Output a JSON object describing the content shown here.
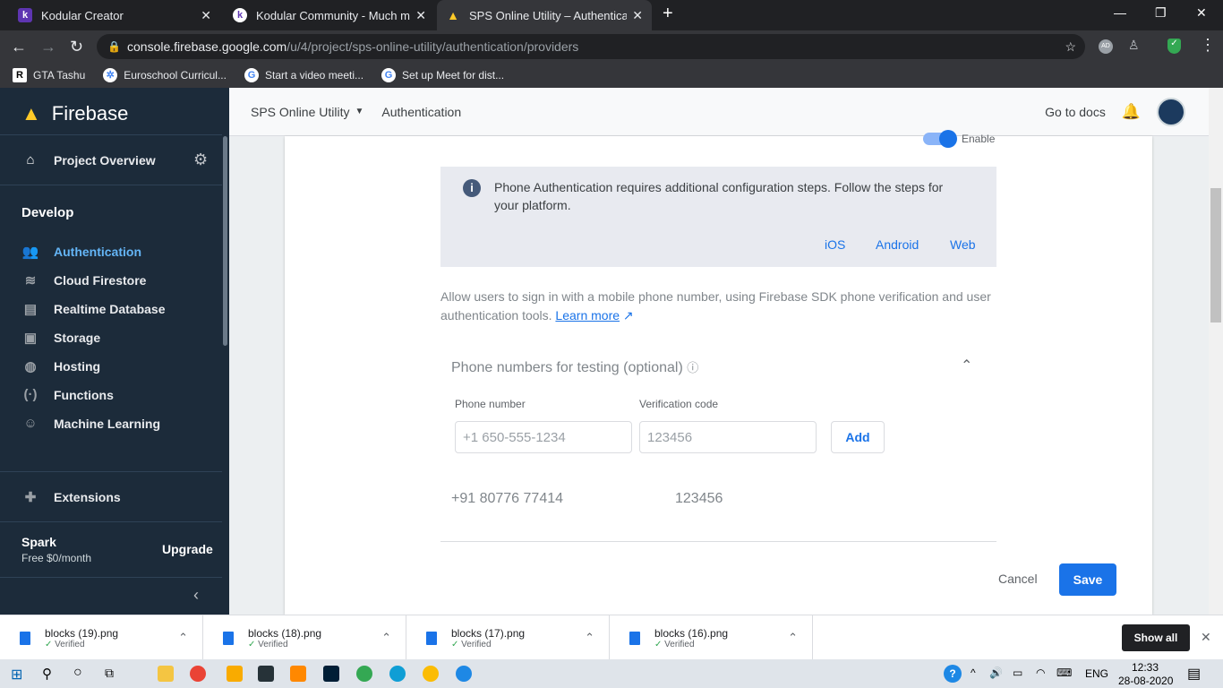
{
  "browser": {
    "tabs": [
      {
        "title": "Kodular Creator",
        "icon": "k"
      },
      {
        "title": "Kodular Community - Much more",
        "icon": "k"
      },
      {
        "title": "SPS Online Utility – Authentication",
        "icon": "firebase"
      }
    ],
    "url_host": "console.firebase.google.com",
    "url_path": "/u/4/project/sps-online-utility/authentication/providers",
    "bookmarks": [
      "GTA Tashu",
      "Euroschool Curricul...",
      "Start a video meeti...",
      "Set up Meet for dist..."
    ],
    "profile_badge": "AD"
  },
  "sidebar": {
    "brand": "Firebase",
    "overview": "Project Overview",
    "section": "Develop",
    "items": [
      {
        "label": "Authentication",
        "icon": "people-icon"
      },
      {
        "label": "Cloud Firestore",
        "icon": "firestore-icon"
      },
      {
        "label": "Realtime Database",
        "icon": "database-icon"
      },
      {
        "label": "Storage",
        "icon": "storage-icon"
      },
      {
        "label": "Hosting",
        "icon": "hosting-icon"
      },
      {
        "label": "Functions",
        "icon": "functions-icon"
      },
      {
        "label": "Machine Learning",
        "icon": "robot-icon"
      }
    ],
    "extensions": "Extensions",
    "plan": "Spark",
    "plan_price": "Free $0/month",
    "upgrade": "Upgrade"
  },
  "header": {
    "project": "SPS Online Utility",
    "page": "Authentication",
    "docs": "Go to docs"
  },
  "content": {
    "enable_label": "Enable",
    "info": "Phone Authentication requires additional configuration steps. Follow the steps for your platform.",
    "platforms": [
      "iOS",
      "Android",
      "Web"
    ],
    "description": "Allow users to sign in with a mobile phone number, using Firebase SDK phone verification and user authentication tools.",
    "learn_more": "Learn more",
    "testing_title": "Phone numbers for testing (optional)",
    "phone_label": "Phone number",
    "code_label": "Verification code",
    "phone_placeholder": "+1 650-555-1234",
    "code_placeholder": "123456",
    "add": "Add",
    "entries": [
      {
        "phone": "+91 80776 77414",
        "code": "123456"
      }
    ],
    "cancel": "Cancel",
    "save": "Save"
  },
  "downloads": {
    "items": [
      {
        "name": "blocks (19).png",
        "status": "Verified"
      },
      {
        "name": "blocks (18).png",
        "status": "Verified"
      },
      {
        "name": "blocks (17).png",
        "status": "Verified"
      },
      {
        "name": "blocks (16).png",
        "status": "Verified"
      }
    ],
    "show_all": "Show all"
  },
  "taskbar": {
    "lang": "ENG",
    "time": "12:33",
    "date": "28-08-2020"
  }
}
